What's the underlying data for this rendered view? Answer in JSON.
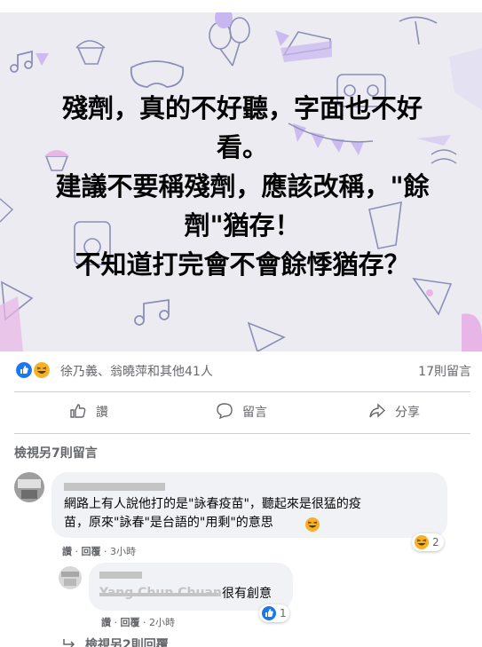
{
  "post": {
    "lines": [
      "殘劑，真的不好聽，字面也不好",
      "看。",
      "建議不要稱殘劑，應該改稱，\"餘",
      "劑\"猶存！",
      "不知道打完會不會餘悸猶存？"
    ],
    "background_color": "#ecebf2",
    "accent_color": "#c8b6f0"
  },
  "reactions": {
    "names": "徐乃義、翁曉萍和其他41人",
    "comment_count": "17則留言",
    "icons": [
      "like-icon",
      "haha-icon"
    ]
  },
  "actions": {
    "like": "讚",
    "comment": "留言",
    "share": "分享"
  },
  "comments_section": {
    "view_more": "檢視另7則留言",
    "comment1": {
      "text_line1": "網路上有人說他打的是\"詠春疫苗\"，聽起來是很猛的疫",
      "text_line2": "苗，原來\"詠春\"是台語的\"用剩\"的意思",
      "like": "讚",
      "reply": "回覆",
      "time": "3小時",
      "reaction_count": "2",
      "reaction_icon": "haha-icon"
    },
    "reply1": {
      "author": "Yang Chun Chuan",
      "text": "很有創意",
      "like": "讚",
      "reply": "回覆",
      "time": "2小時",
      "reaction_count": "1",
      "reaction_icon": "like-icon"
    },
    "view_replies": "檢視另2則回覆"
  },
  "colors": {
    "text_primary": "#050505",
    "text_secondary": "#65676b",
    "like_blue": "#1877f2",
    "haha_yellow": "#f7b125",
    "bubble_bg": "#f0f2f5"
  }
}
